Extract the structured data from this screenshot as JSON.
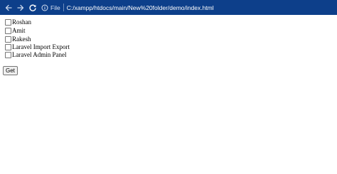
{
  "browser": {
    "site_info_label": "File",
    "url": "C:/xampp/htdocs/main/New%20folder/demo/index.html",
    "colors": {
      "toolbar_bg": "#0d3f8a",
      "url_text": "#ffffff"
    }
  },
  "page": {
    "checkboxes": [
      {
        "label": "Roshan",
        "checked": false
      },
      {
        "label": "Amit",
        "checked": false
      },
      {
        "label": "Rakesh",
        "checked": false
      },
      {
        "label": "Laravel Import Export",
        "checked": false
      },
      {
        "label": "Laravel Admin Panel",
        "checked": false
      }
    ],
    "get_button_label": "Get"
  }
}
